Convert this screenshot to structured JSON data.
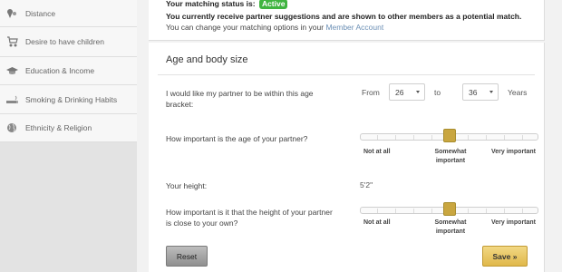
{
  "sidebar": {
    "items": [
      {
        "label": "Distance",
        "icon": "map-marker-icon"
      },
      {
        "label": "Desire to have children",
        "icon": "stroller-icon"
      },
      {
        "label": "Education & Income",
        "icon": "graduation-cap-icon"
      },
      {
        "label": "Smoking & Drinking Habits",
        "icon": "cigarette-icon"
      },
      {
        "label": "Ethnicity & Religion",
        "icon": "globe-icon"
      }
    ]
  },
  "status": {
    "prefix": "Your matching status is:",
    "badge": "Active",
    "line2": "You currently receive partner suggestions and are shown to other members as a potential match.",
    "line3_prefix": "You can change your matching options in your",
    "line3_link": "Member Account"
  },
  "section": {
    "title": "Age and body size",
    "age_bracket": {
      "label": "I would like my partner to be within this age bracket:",
      "from_label": "From",
      "from_value": "26",
      "to_label": "to",
      "to_value": "36",
      "unit": "Years"
    },
    "age_importance": {
      "label": "How important is the age of your partner?",
      "value": 0.5,
      "scale": {
        "low": "Not at all",
        "mid": "Somewhat important",
        "high": "Very important"
      }
    },
    "height": {
      "label": "Your height:",
      "value": "5'2\""
    },
    "height_importance": {
      "label": "How important is it that the height of your partner is close to your own?",
      "value": 0.5,
      "scale": {
        "low": "Not at all",
        "mid": "Somewhat important",
        "high": "Very important"
      }
    }
  },
  "buttons": {
    "reset": "Reset",
    "save": "Save »"
  },
  "colors": {
    "active_badge": "#3fb43f",
    "slider_thumb": "#c9a640",
    "save_button": "#e8c65e",
    "link": "#6b8fb5"
  }
}
